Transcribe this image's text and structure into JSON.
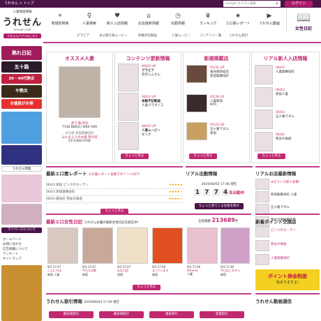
{
  "topbar": {
    "breadcrumb": "うれせん > トップ",
    "search_placeholder": "Google カスタム検索",
    "search_icon": "search-icon",
    "login_label": "ログイン"
  },
  "logo": {
    "tagline": "人妻風俗情報",
    "name": "うれせん",
    "url": "ure-sen.com",
    "badge": "うれせんアプリはこちら"
  },
  "nav": {
    "items": [
      {
        "label": "地域別検索",
        "icon": "map-pin-icon"
      },
      {
        "label": "人妻検索",
        "icon": "woman-icon"
      },
      {
        "label": "新人入店情報",
        "icon": "heart-icon"
      },
      {
        "label": "お店最新情報",
        "icon": "shop-icon"
      },
      {
        "label": "出勤情報",
        "icon": "clock-icon"
      },
      {
        "label": "ランキング",
        "icon": "crown-icon"
      },
      {
        "label": "エロ妻レポート",
        "icon": "star-icon"
      },
      {
        "label": "うれせん動画",
        "icon": "play-icon"
      }
    ],
    "sub": [
      "グラビア",
      "未公開写真ムービー",
      "体験手記動画",
      "人妻ムービー",
      "コンテンツ一覧",
      "うれせん割引"
    ],
    "diary_label": "女性日記",
    "diary_icon": "book-icon"
  },
  "sidebar": {
    "banners": [
      "熟れ日記",
      "五十路",
      "30・40代熟女",
      "や熟女",
      "お値段がお得",
      "うれせん特集",
      "マイページについて"
    ],
    "links": [
      "ホームページ",
      "お問い合わせ",
      "広告掲載について",
      "アンケート",
      "サイトマップ"
    ]
  },
  "sections": {
    "recommend": {
      "title": "オススメ人妻",
      "caption": "まりあ(43)",
      "stats": "T158 B86(E) W60 H89",
      "shop": "大久保 新宿歌舞伎町",
      "desc": "みたまらうの太陽 雪が塔",
      "tel": "03-5368-4356"
    },
    "contents": {
      "title": "コンテンツ更新情報",
      "items": [
        {
          "date": "06/03 UP",
          "cat": "グラビア",
          "text": "宮月じんせん"
        },
        {
          "date": "06/03 UP",
          "cat": "体験手記動画",
          "text": "人妻パラダイス"
        },
        {
          "date": "06/03 UP",
          "cat": "人妻ムービー",
          "text": "ゆうき"
        }
      ],
      "more": "ちょっと見る"
    },
    "newshops": {
      "title": "新規掲載店",
      "items": [
        {
          "date": "05/31 UP",
          "text": "長谷部新宿店",
          "sub": "新宿歌舞伎町"
        },
        {
          "date": "05/28 UP",
          "text": "人妻新宿",
          "sub": "NTR"
        },
        {
          "date": "05/23 UP",
          "text": "五十路マダム",
          "sub": "新宿"
        }
      ],
      "more": "ちょっと見る"
    },
    "realnew": {
      "title": "リアル新人入店情報",
      "items": [
        {
          "date": "06/03",
          "text": "人妻歌舞伎町"
        },
        {
          "date": "06/03",
          "text": "新宿人妻"
        },
        {
          "date": "06/03",
          "text": "五十路マダム"
        },
        {
          "date": "06/02",
          "text": "熟女の風俗"
        }
      ],
      "more": "ちょっと見る"
    },
    "eroreport": {
      "title": "最新エロ妻レポート",
      "subtitle": "エロ妻レポート投稿でポイントGET!",
      "rows": [
        {
          "date": "06/03",
          "text": "新宿 ピンクのカーテン",
          "stars": "★★★★★"
        },
        {
          "date": "06/03",
          "text": "新宿歌舞伎町",
          "stars": "★★★★☆"
        },
        {
          "date": "06/03",
          "text": "錦糸町 熟女の風俗",
          "stars": "★★★★☆"
        }
      ],
      "more": "ちょっと見る"
    },
    "realcount": {
      "title": "リアル出勤情報",
      "datetime": "2019/06/03 17:46 現在",
      "count_digits": [
        "1",
        "7",
        "7",
        "4"
      ],
      "suffix": "名出勤中",
      "button": "ちょっと見てくる女性を探す"
    },
    "shopnews": {
      "title": "リアルお店最新情報",
      "items": [
        {
          "text": "★セクシス新人多数!"
        },
        {
          "text": "新宿歌舞伎町 人妻"
        },
        {
          "text": "五十路マダム"
        },
        {
          "text": "熟女の風俗最終章"
        }
      ],
      "more": "ちょっと見る"
    },
    "diary": {
      "title": "最新エロ女性日記",
      "subtitle": "うれせん女優の最新女性日記を配信中!",
      "total_label": "全投稿数",
      "total_value": "213689",
      "total_unit": "件",
      "entries": [
        {
          "time": "9/3 17:47",
          "name": "こんにちは",
          "shop": "新宿 人妻"
        },
        {
          "time": "9/3 17:47",
          "name": "今日も出勤",
          "shop": "新宿"
        },
        {
          "time": "9/3 17:47",
          "name": "お礼日記",
          "shop": "池袋"
        },
        {
          "time": "9/3 17:46",
          "name": "まっています",
          "shop": "新宿"
        },
        {
          "time": "9/3 17:46",
          "name": "Himeno",
          "shop": "人妻"
        },
        {
          "time": "9/3 17:46",
          "name": "今日はこれから",
          "shop": "新宿"
        }
      ],
      "more": "ちょっと見る"
    },
    "points": {
      "title": "新着ポイント交換店",
      "items": [
        {
          "text": "ピンクのカーテン"
        },
        {
          "text": "熟女の風俗"
        },
        {
          "text": "人妻歌舞伎町"
        }
      ],
      "banner_text": "ポイント換金制度",
      "banner_sub": "始まりますよ!"
    },
    "discount": {
      "title": "うれせん割引情報",
      "datetime": "2019/06/03 17:29 現在",
      "tabs": [
        "最安値割引",
        "最安価割引",
        "激安割引",
        "新着割引"
      ]
    },
    "video": {
      "title": "うれせん動画通信"
    }
  }
}
